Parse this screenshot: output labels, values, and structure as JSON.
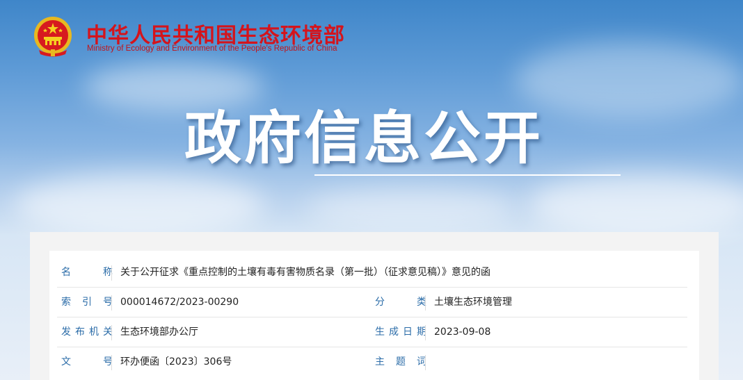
{
  "header": {
    "title_cn": "中华人民共和国生态环境部",
    "title_en": "Ministry of Ecology and Environment of the People's Republic of China",
    "emblem_icon": "national-emblem-icon"
  },
  "banner": {
    "title": "政府信息公开"
  },
  "info": {
    "name_label": "名称",
    "name_value": "关于公开征求《重点控制的土壤有毒有害物质名录（第一批）（征求意见稿）》意见的函",
    "index_label": "索引号",
    "index_value": "000014672/2023-00290",
    "category_label": "分类",
    "category_value": "土壤生态环境管理",
    "issuer_label": "发布机关",
    "issuer_value": "生态环境部办公厅",
    "date_label": "生成日期",
    "date_value": "2023-09-08",
    "docno_label": "文号",
    "docno_value": "环办便函〔2023〕306号",
    "subject_label": "主题词",
    "subject_value": ""
  },
  "colors": {
    "brand_red": "#d4141c",
    "label_blue": "#2b6ca8",
    "sky_top": "#3f86c9"
  }
}
